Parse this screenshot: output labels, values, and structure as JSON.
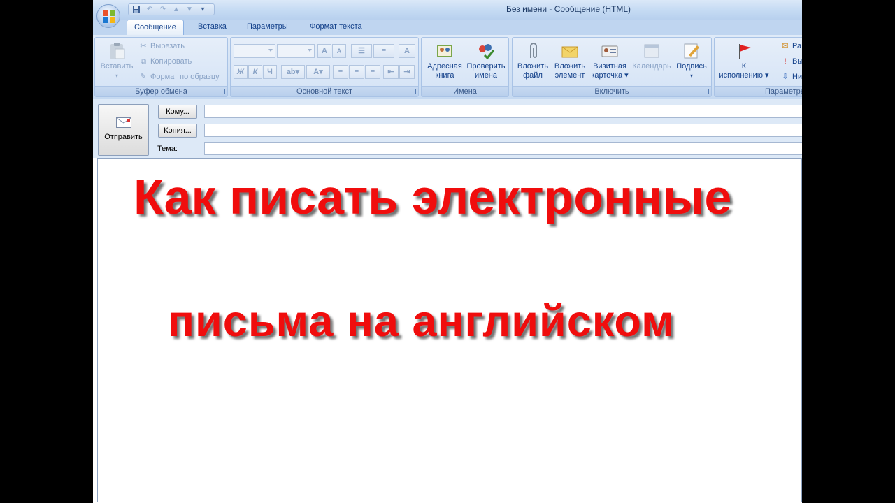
{
  "window": {
    "title": "Без имени - Сообщение (HTML)"
  },
  "quick_access": {
    "icons": [
      "save-icon",
      "undo-icon",
      "redo-icon",
      "up-arrow-icon",
      "down-arrow-icon",
      "customize-icon"
    ]
  },
  "tabs": [
    {
      "label": "Сообщение",
      "active": true
    },
    {
      "label": "Вставка",
      "active": false
    },
    {
      "label": "Параметры",
      "active": false
    },
    {
      "label": "Формат текста",
      "active": false
    }
  ],
  "ribbon": {
    "clipboard": {
      "caption": "Буфер обмена",
      "paste": "Вставить",
      "cut": "Вырезать",
      "copy": "Копировать",
      "format_painter": "Формат по образцу"
    },
    "basic_text": {
      "caption": "Основной текст",
      "bold": "Ж",
      "italic": "К",
      "underline": "Ч"
    },
    "names": {
      "caption": "Имена",
      "address_book_1": "Адресная",
      "address_book_2": "книга",
      "check_names_1": "Проверить",
      "check_names_2": "имена"
    },
    "include": {
      "caption": "Включить",
      "attach_file_1": "Вложить",
      "attach_file_2": "файл",
      "attach_item_1": "Вложить",
      "attach_item_2": "элемент",
      "business_card_1": "Визитная",
      "business_card_2": "карточка",
      "calendar": "Календарь",
      "signature": "Подпись"
    },
    "options": {
      "caption": "Параметры",
      "follow_up_1": "К",
      "follow_up_2": "исполнению",
      "item_1": "Ра",
      "item_2": "Вы",
      "item_3": "Ни"
    }
  },
  "header": {
    "send": "Отправить",
    "to": "Кому...",
    "cc": "Копия...",
    "subject": "Тема:",
    "to_value": "",
    "cc_value": "",
    "subject_value": ""
  },
  "body": {
    "line1": "Как писать электронные",
    "line2": "письма на английском",
    "text_color": "#f00d0d"
  },
  "colors": {
    "ribbon_text": "#15428b",
    "frame": "#c4daf3"
  }
}
